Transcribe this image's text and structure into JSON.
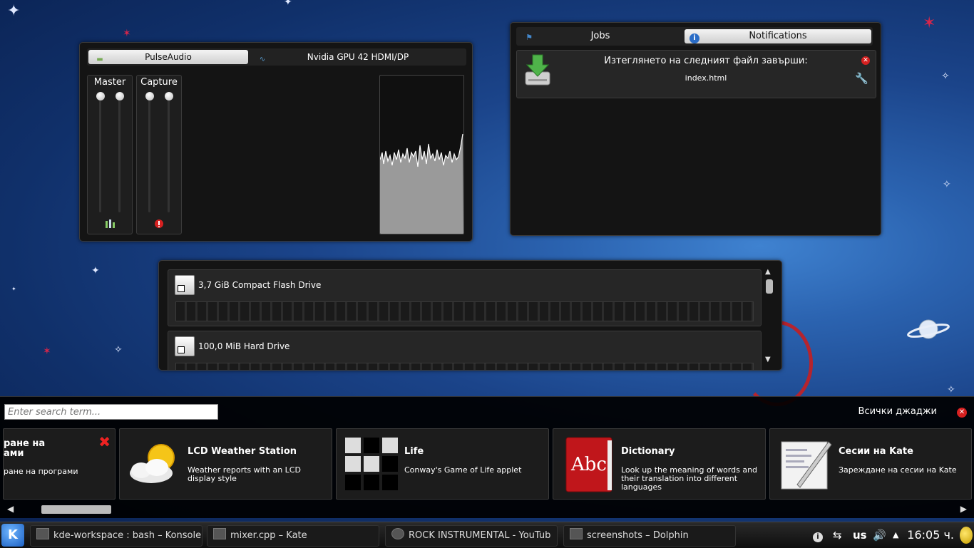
{
  "mixer": {
    "tabs": [
      "PulseAudio",
      "Nvidia GPU 42 HDMI/DP"
    ],
    "channels": [
      {
        "label": "Master",
        "icon": "equalizer-icon"
      },
      {
        "label": "Capture",
        "icon": "record-icon"
      }
    ]
  },
  "notifications": {
    "tabs": [
      "Jobs",
      "Notifications"
    ],
    "item": {
      "title": "Изтеглянето на следният файл завърши:",
      "file": "index.html",
      "icon": "download-complete-icon"
    }
  },
  "devices": {
    "items": [
      {
        "label": "3,7 GiB Compact Flash Drive",
        "icon": "flash-drive-icon"
      },
      {
        "label": "100,0 MiB Hard Drive",
        "icon": "hard-drive-icon"
      }
    ]
  },
  "widget_explorer": {
    "search_placeholder": "Enter search term...",
    "all_widgets_label": "Всички джаджи",
    "widgets": [
      {
        "name": "ране на\nами",
        "description": "ране на програми",
        "icon": "launcher-icon"
      },
      {
        "name": "LCD Weather Station",
        "description": "Weather reports with an LCD display style",
        "icon": "weather-icon"
      },
      {
        "name": "Life",
        "description": "Conway's Game of Life applet",
        "icon": "life-grid-icon"
      },
      {
        "name": "Dictionary",
        "description": "Look up the meaning of words and their translation into different languages",
        "icon": "dictionary-icon",
        "icon_text": "Abc"
      },
      {
        "name": "Сесии на Kate",
        "description": "Зареждане на сесии на Kate",
        "icon": "kate-sessions-icon"
      }
    ]
  },
  "taskbar": {
    "tasks": [
      {
        "label": "kde-workspace : bash – Konsole",
        "icon": "konsole-icon"
      },
      {
        "label": "mixer.cpp – Kate",
        "icon": "kate-icon"
      },
      {
        "label": "ROCK INSTRUMENTAL - YouTub",
        "icon": "browser-icon"
      },
      {
        "label": "screenshots – Dolphin",
        "icon": "dolphin-icon"
      }
    ],
    "keyboard_layout": "us",
    "clock": "16:05 ч."
  }
}
